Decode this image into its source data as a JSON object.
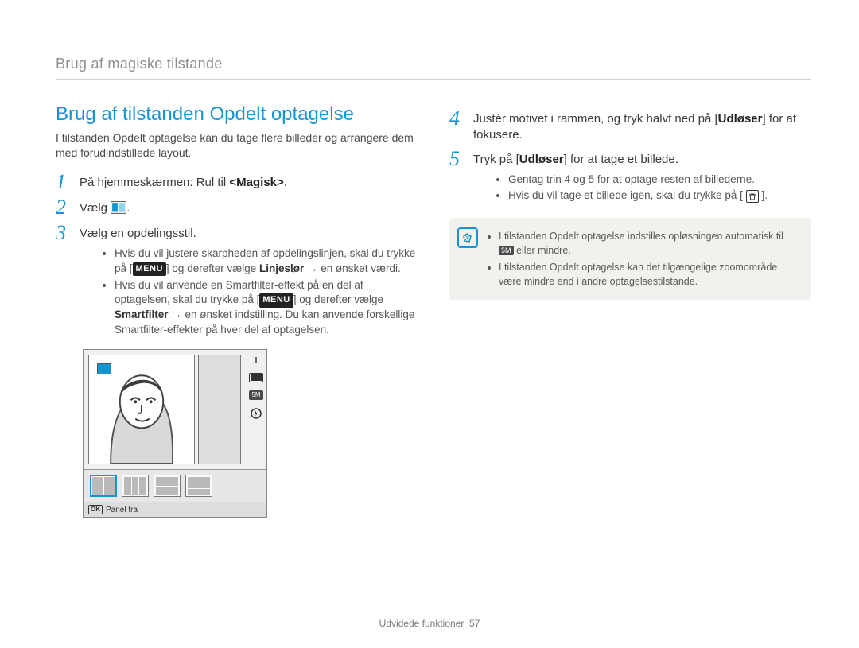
{
  "running_head": "Brug af magiske tilstande",
  "left": {
    "title": "Brug af tilstanden Opdelt optagelse",
    "intro": "I tilstanden Opdelt optagelse kan du tage flere billeder og arrangere dem med forudindstillede layout.",
    "step1_pre": "På hjemmeskærmen: Rul til ",
    "step1_bold": "<Magisk>",
    "step1_post": ".",
    "step2": "Vælg ",
    "step2_post": ".",
    "step3": "Vælg en opdelingsstil.",
    "b1_pre": "Hvis du vil justere skarpheden af opdelingslinjen, skal du trykke på [",
    "menu": "MENU",
    "b1_mid": "] og derefter vælge ",
    "b1_bold": "Linjeslør",
    "b1_arrow": " → en ønsket værdi.",
    "b2_pre": "Hvis du vil anvende en Smartfilter-effekt på en del af optagelsen, skal du trykke på [",
    "b2_mid": "] og derefter vælge ",
    "b2_bold": "Smartfilter",
    "b2_post": " → en ønsket indstilling. Du kan anvende forskellige Smartfilter-effekter på hver del af optagelsen."
  },
  "right": {
    "step4_pre": "Justér motivet i rammen, og tryk halvt ned på [",
    "step4_bold": "Udløser",
    "step4_post": "] for at fokusere.",
    "step5_pre": "Tryk på [",
    "step5_bold": "Udløser",
    "step5_post": "] for at tage et billede.",
    "b1": "Gentag trin 4 og 5 for at optage resten af billederne.",
    "b2_pre": "Hvis du vil tage et billede igen, skal du trykke på [",
    "b2_post": "].",
    "note1_pre": "I tilstanden Opdelt optagelse indstilles opløsningen automatisk til ",
    "note1_res": "5M",
    "note1_post": " eller mindre.",
    "note2": "I tilstanden Opdelt optagelse kan det tilgængelige zoomområde være mindre end i andre optagelsestilstande."
  },
  "cam": {
    "footer_label": "Panel fra",
    "ok": "OK"
  },
  "footer": {
    "section": "Udvidede funktioner",
    "page": "57"
  }
}
